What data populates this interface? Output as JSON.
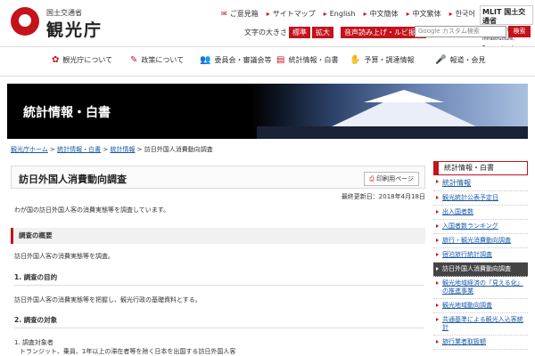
{
  "header": {
    "ministry": "国土交通省",
    "agency": "観光庁",
    "links": [
      "ご意見箱",
      "サイトマップ",
      "English",
      "中文簡体",
      "中文繁体",
      "한국어"
    ],
    "mlit": "MLIT 国土交通省",
    "mlit_sub": "Ministry of Land, Infrastructure, Transport and Tourism",
    "font_size_label": "文字の大きさ",
    "font_std": "標準",
    "font_large": "拡大",
    "audio_btn": "音声読み上げ・ルビ振り",
    "search_placeholder": "Google カスタム検索",
    "search_btn": "検索"
  },
  "nav": [
    "観光庁について",
    "政策について",
    "委員会・審議会等",
    "統計情報・白書",
    "予算・調達情報",
    "報道・会見"
  ],
  "banner": {
    "title": "統計情報・白書"
  },
  "breadcrumb": [
    "観光庁ホーム",
    "統計情報・白書",
    "統計情報",
    "訪日外国人消費動向調査"
  ],
  "page": {
    "title": "訪日外国人消費動向調査",
    "print": "印刷用ページ",
    "updated": "最終更新日：2018年4月18日",
    "intro": "わが国の訪日外国人客の消費実態等を調査しています。",
    "section1": "調査の概要",
    "section1_text": "訪日外国人客の消費実態等を調査。",
    "sub1": "1. 調査の目的",
    "sub1_text": "訪日外国人客の消費実態等を把握し、観光行政の基礎資料とする。",
    "sub2": "2. 調査の対象",
    "sub2_text1": "1. 調査対象者",
    "sub2_text2": "トランジット、乗員、1年以上の滞在者等を除く日本を出国する訪日外国人客"
  },
  "sidebar": {
    "header": "統計情報・白書",
    "top": "統計情報",
    "items": [
      "観光統計公表予定日",
      "出入国者数",
      "入国者数ランキング",
      "旅行・観光消費動向調査",
      "宿泊旅行統計調査",
      "訪日外国人消費動向調査",
      "観光地域経済の「見える化」の推進事業",
      "観光地域動向調査",
      "共通基準による観光入込客統計",
      "旅行業者取扱額"
    ],
    "active_index": 5
  }
}
